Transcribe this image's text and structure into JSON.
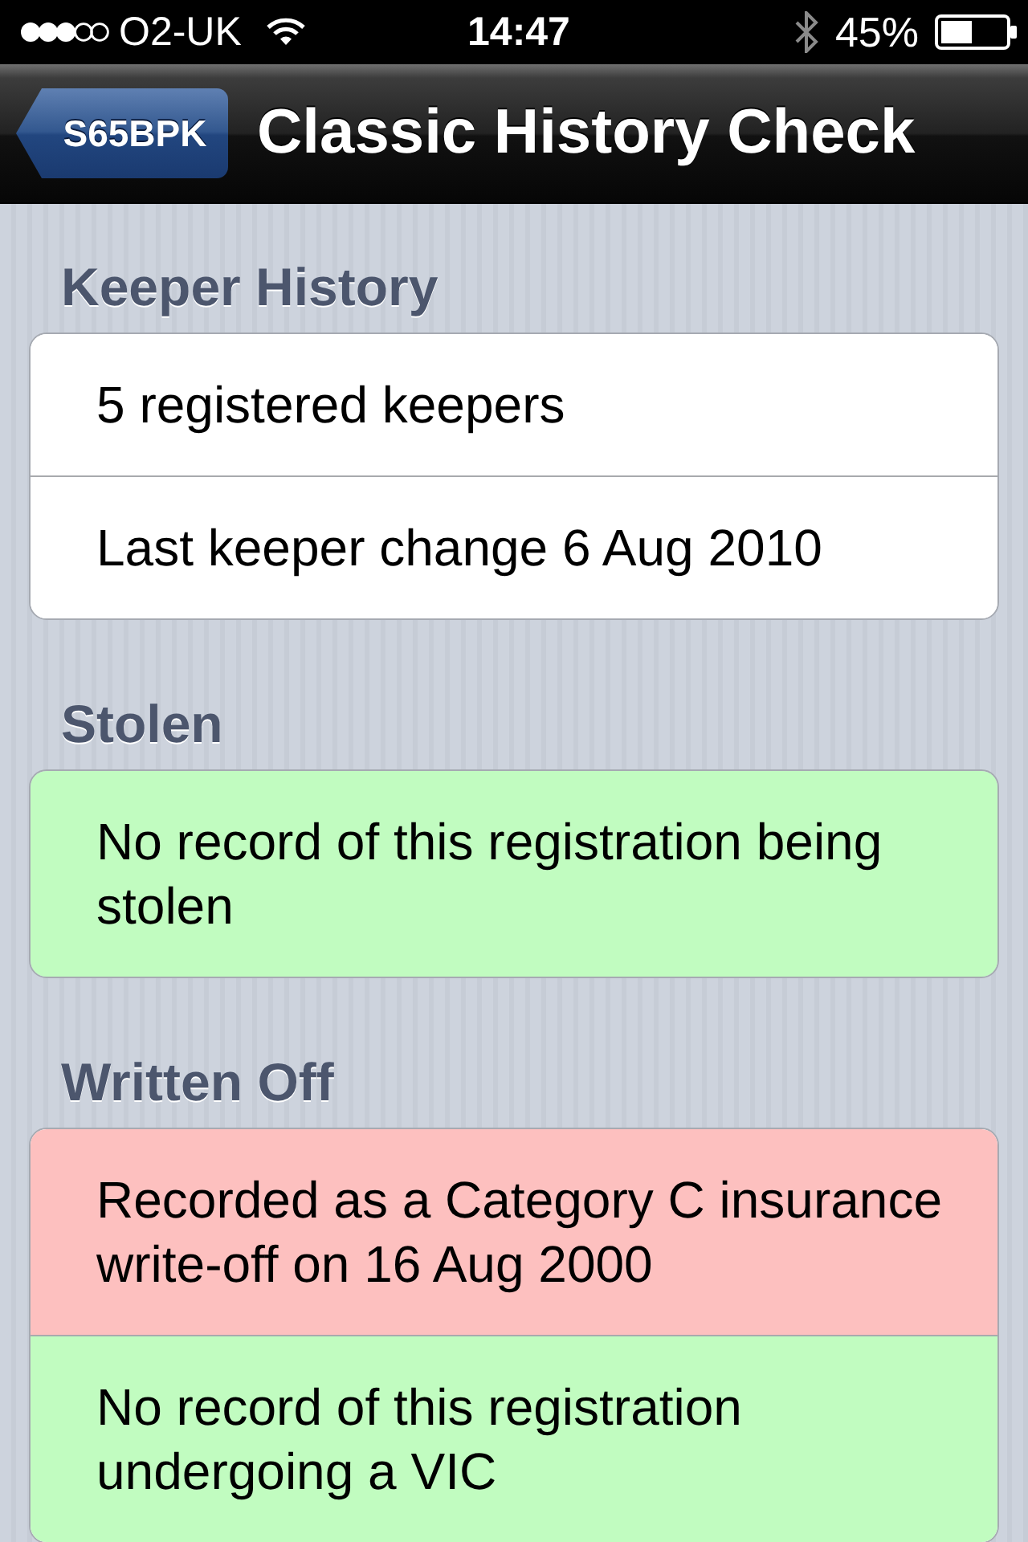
{
  "status_bar": {
    "carrier": "O2-UK",
    "time": "14:47",
    "battery": "45%"
  },
  "nav_bar": {
    "back_button": "S65BPK",
    "title": "Classic History Check"
  },
  "sections": [
    {
      "title": "Keeper History",
      "rows": [
        {
          "text": "5 registered keepers",
          "color": "#ffffff"
        },
        {
          "text": "Last keeper change 6 Aug 2010",
          "color": "#ffffff"
        }
      ]
    },
    {
      "title": "Stolen",
      "rows": [
        {
          "text": "No record of this registration being stolen",
          "color": "#c1fcc0"
        }
      ]
    },
    {
      "title": "Written Off",
      "rows": [
        {
          "text": "Recorded as a Category C insurance write-off on 16 Aug 2000",
          "color": "#fdc0bf"
        },
        {
          "text": "No record of this registration undergoing a VIC",
          "color": "#c1fcc0"
        }
      ]
    }
  ]
}
